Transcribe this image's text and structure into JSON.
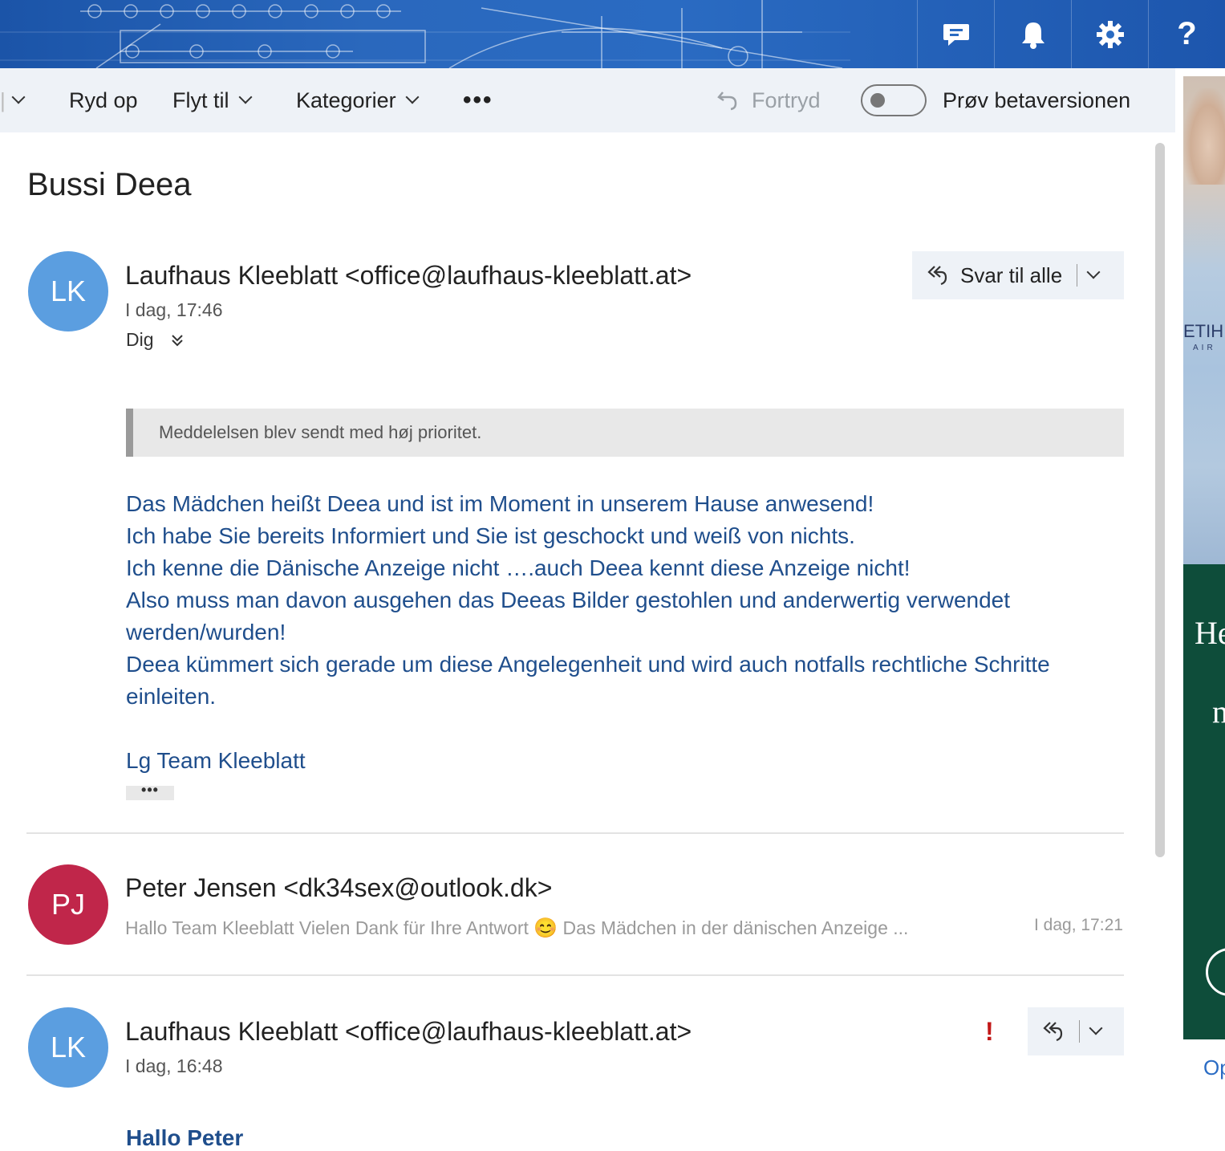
{
  "header": {
    "icons": [
      "chat-icon",
      "bell-icon",
      "gear-icon",
      "help-icon"
    ]
  },
  "toolbar": {
    "sweep_label": "Ryd op",
    "move_label": "Flyt til",
    "categories_label": "Kategorier",
    "more_label": "•••",
    "undo_label": "Fortryd",
    "beta_label": "Prøv betaversionen",
    "beta_toggle_on": false
  },
  "message": {
    "subject": "Bussi Deea"
  },
  "thread": [
    {
      "initials": "LK",
      "avatar_color": "#5b9ee0",
      "sender": "Laufhaus Kleeblatt <office@laufhaus-kleeblatt.at>",
      "time": "I dag, 17:46",
      "to": "Dig",
      "reply_all_label": "Svar til alle",
      "priority_notice": "Meddelelsen blev sendt med høj prioritet.",
      "body_lines": [
        "Das Mädchen heißt Deea und ist im Moment in unserem Hause anwesend!",
        "Ich habe Sie bereits Informiert und Sie ist geschockt und weiß von nichts.",
        "Ich kenne die Dänische Anzeige nicht ….auch Deea kennt diese Anzeige nicht!",
        "Also muss man davon ausgehen das Deeas Bilder gestohlen und anderwertig verwendet",
        "werden/wurden!",
        "Deea kümmert sich gerade um diese Angelegenheit und wird auch notfalls rechtliche Schritte",
        "einleiten."
      ],
      "signature": "Lg Team Kleeblatt",
      "expand_label": "•••"
    },
    {
      "initials": "PJ",
      "avatar_color": "#c0264a",
      "sender": "Peter Jensen <dk34sex@outlook.dk>",
      "preview_part1": "Hallo Team Kleeblatt Vielen Dank für Ihre Antwort",
      "preview_emoji": "😊",
      "preview_part2": "Das Mädchen in der dänischen Anzeige ...",
      "time": "I dag, 17:21"
    },
    {
      "initials": "LK",
      "avatar_color": "#5b9ee0",
      "sender": "Laufhaus Kleeblatt <office@laufhaus-kleeblatt.at>",
      "time": "I dag, 16:48",
      "importance_mark": "!",
      "greeting": "Hallo Peter"
    }
  ],
  "ad": {
    "heading_fragment": "He",
    "line2_fragment": "n",
    "link_fragment": "Op",
    "jersey_text": "ETIH",
    "jersey_sub": "AIR"
  }
}
